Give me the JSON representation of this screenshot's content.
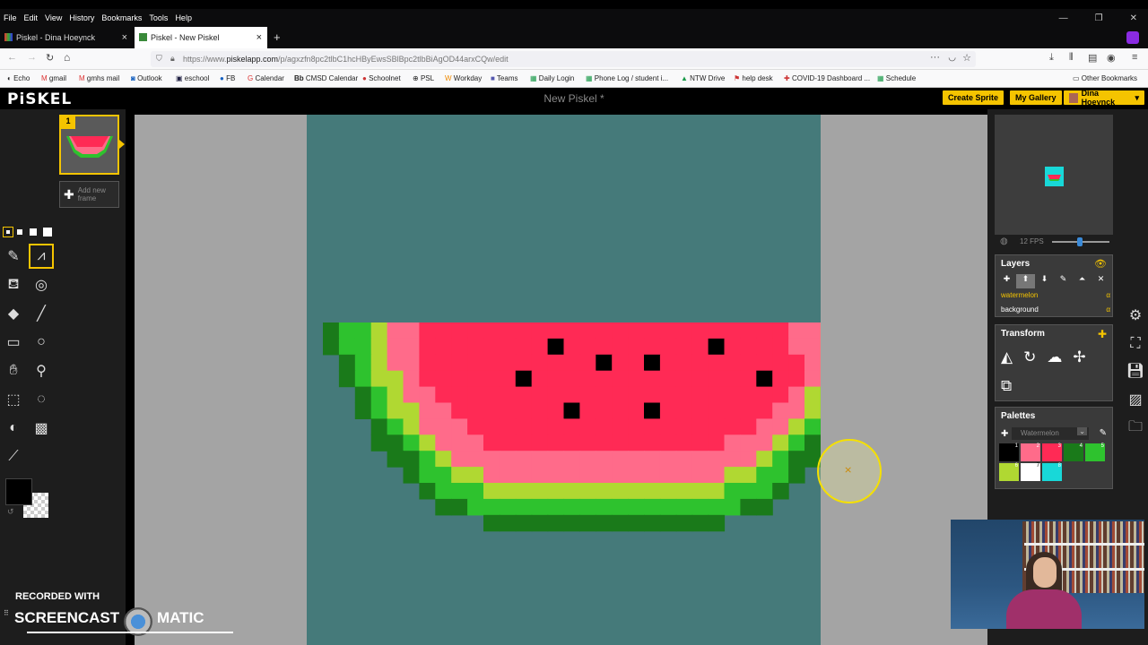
{
  "browser": {
    "menu": [
      "File",
      "Edit",
      "View",
      "History",
      "Bookmarks",
      "Tools",
      "Help"
    ],
    "tabs": [
      {
        "label": "Piskel - Dina Hoeynck"
      },
      {
        "label": "Piskel - New Piskel"
      }
    ],
    "url_prefix": "https://www.",
    "url_domain": "piskelapp.com",
    "url_rest": "/p/agxzfn8pc2tlbC1hcHByEwsSBlBpc2tlbBiAgOD44arxCQw/edit",
    "bookmarks": [
      "Echo",
      "gmail",
      "gmhs mail",
      "Outlook",
      "eschool",
      "FB",
      "Calendar",
      "CMSD Calendar",
      "Schoolnet",
      "PSL",
      "Workday",
      "Teams",
      "Daily Login",
      "Phone Log / student i...",
      "NTW Drive",
      "help desk",
      "COVID-19 Dashboard ...",
      "Schedule"
    ],
    "other_bookmarks": "Other Bookmarks"
  },
  "app": {
    "logo": "PiSKEL",
    "title": "New Piskel *",
    "create_sprite": "Create Sprite",
    "my_gallery": "My Gallery",
    "user": "Dina Hoeynck"
  },
  "frames": {
    "frame_number": "1",
    "add_frame": "Add new frame"
  },
  "preview": {
    "fps_label": "12 FPS",
    "fps_value": 12
  },
  "layers": {
    "title": "Layers",
    "items": [
      {
        "name": "watermelon",
        "opacity": "α",
        "active": true
      },
      {
        "name": "background",
        "opacity": "α",
        "active": false
      }
    ]
  },
  "transform": {
    "title": "Transform"
  },
  "palettes": {
    "title": "Palettes",
    "selected": "Watermelon",
    "swatch_numbers": [
      "1",
      "2",
      "3",
      "4",
      "5",
      "6",
      "7",
      "8"
    ],
    "colors": [
      "#000000",
      "#ff6b8a",
      "#ff2a55",
      "#1a7a1a",
      "#2ec22e",
      "#b0d832",
      "#ffffff",
      "#18d8d8"
    ]
  },
  "colors": {
    "primary": "#000000",
    "accent": "#f5c400",
    "canvas_bg": "#457a7a"
  },
  "watermark": {
    "line1": "RECORDED WITH",
    "line2a": "SCREENCAST",
    "line2b": "MATIC"
  }
}
